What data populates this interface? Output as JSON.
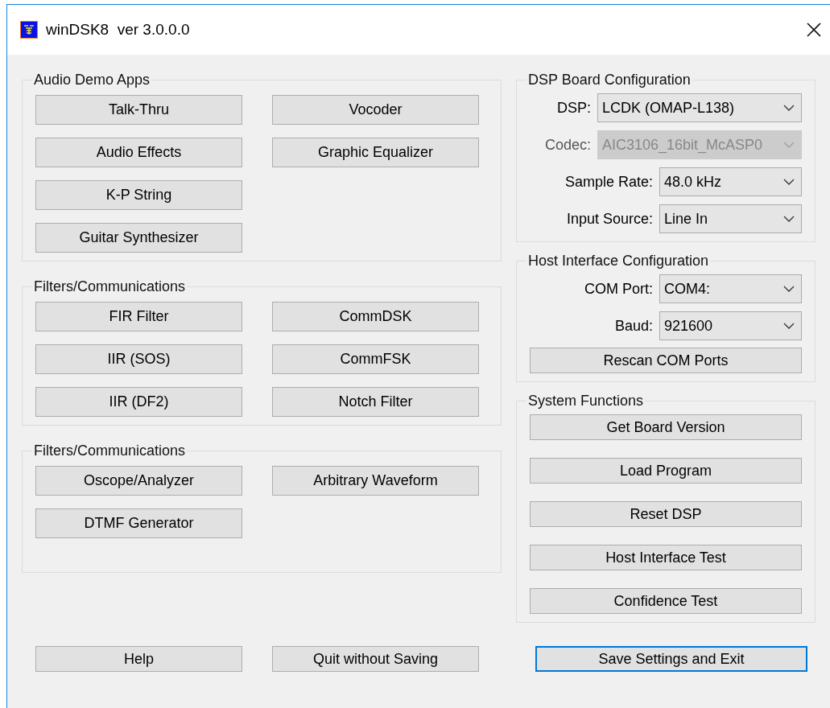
{
  "window": {
    "title": "winDSK8  ver 3.0.0.0"
  },
  "app_groups": [
    {
      "title": "Audio Demo Apps",
      "rows": [
        [
          "Talk-Thru",
          "Vocoder"
        ],
        [
          "Audio Effects",
          "Graphic Equalizer"
        ],
        [
          "K-P String"
        ],
        [
          "Guitar Synthesizer"
        ]
      ]
    },
    {
      "title": "Filters/Communications",
      "rows": [
        [
          "FIR Filter",
          "CommDSK"
        ],
        [
          "IIR (SOS)",
          "CommFSK"
        ],
        [
          "IIR (DF2)",
          "Notch Filter"
        ]
      ]
    },
    {
      "title": "Filters/Communications",
      "rows": [
        [
          "Oscope/Analyzer",
          "Arbitrary Waveform"
        ],
        [
          "DTMF Generator"
        ]
      ]
    }
  ],
  "dsp_board": {
    "title": "DSP Board Configuration",
    "fields": [
      {
        "label": "DSP:",
        "value": "LCDK (OMAP-L138)",
        "disabled": false
      },
      {
        "label": "Codec:",
        "value": "AIC3106_16bit_McASP0",
        "disabled": true
      },
      {
        "label": "Sample Rate:",
        "value": "48.0 kHz",
        "disabled": false
      },
      {
        "label": "Input Source:",
        "value": "Line In",
        "disabled": false
      }
    ]
  },
  "host_interface": {
    "title": "Host Interface Configuration",
    "fields": [
      {
        "label": "COM Port:",
        "value": "COM4:",
        "disabled": false
      },
      {
        "label": "Baud:",
        "value": "921600",
        "disabled": false
      }
    ],
    "button": "Rescan COM Ports"
  },
  "system_functions": {
    "title": "System Functions",
    "buttons": [
      "Get Board Version",
      "Load Program",
      "Reset DSP",
      "Host Interface Test",
      "Confidence Test"
    ]
  },
  "bottom_buttons": [
    {
      "label": "Help",
      "default": false
    },
    {
      "label": "Quit without Saving",
      "default": false
    },
    {
      "label": "Save Settings and Exit",
      "default": true
    }
  ]
}
